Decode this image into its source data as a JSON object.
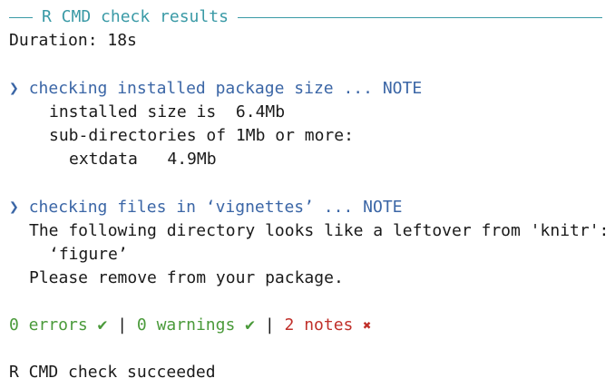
{
  "header": {
    "title": "R CMD check results"
  },
  "duration": "Duration: 18s",
  "sections": [
    {
      "bullet": "❯",
      "heading": "checking installed package size ... NOTE",
      "lines": [
        "installed size is  6.4Mb",
        "sub-directories of 1Mb or more:",
        "extdata   4.9Mb"
      ]
    },
    {
      "bullet": "❯",
      "heading": "checking files in ‘vignettes’ ... NOTE",
      "lines": [
        "The following directory looks like a leftover from 'knitr':",
        "‘figure’",
        "Please remove from your package."
      ]
    }
  ],
  "summary": {
    "errors": "0 errors",
    "warnings": "0 warnings",
    "notes": "2 notes",
    "separator": "|",
    "check_mark": "✔",
    "cross_mark": "✖"
  },
  "footer": "R CMD check succeeded",
  "colors": {
    "rule": "#3a9aa6",
    "heading": "#3b66a6",
    "success": "#4a9a3a",
    "note": "#c0302a"
  }
}
